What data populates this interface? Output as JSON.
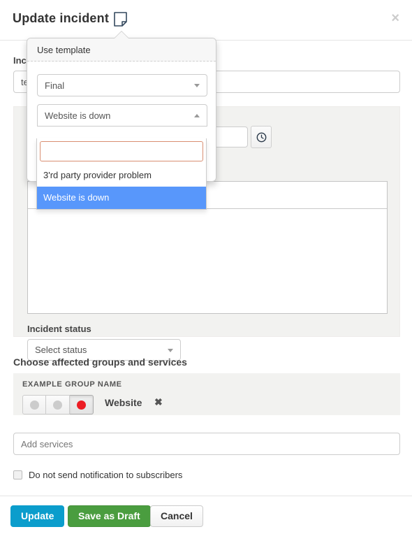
{
  "header": {
    "title": "Update incident",
    "template_icon": "note-template-icon",
    "close_label": "×"
  },
  "form": {
    "incident_title_label": "Incident title",
    "incident_title_value": "te",
    "time_value": "",
    "time_icon": "clock-icon",
    "incident_status_label": "Incident status",
    "status_selected": "Select status",
    "message_value": ""
  },
  "affected": {
    "section_label": "Choose affected groups and services",
    "group_name": "EXAMPLE GROUP NAME",
    "service_name": "Website",
    "remove_icon": "✖",
    "status_buttons": [
      {
        "name": "status-option-1",
        "color": "#cccccc",
        "active": false
      },
      {
        "name": "status-option-2",
        "color": "#cccccc",
        "active": false
      },
      {
        "name": "status-option-3",
        "color": "#ec1c24",
        "active": true
      }
    ],
    "add_services_placeholder": "Add services"
  },
  "notification": {
    "checkbox_label": "Do not send notification to subscribers",
    "checked": false
  },
  "footer": {
    "update_label": "Update",
    "draft_label": "Save as Draft",
    "cancel_label": "Cancel"
  },
  "popover": {
    "title": "Use template",
    "type_selected": "Final",
    "template_selected": "Website is down",
    "search_value": "",
    "options": [
      "3'rd party provider problem",
      "Website is down"
    ],
    "highlighted_option": "Website is down"
  },
  "colors": {
    "update_button": "#0b9dcc",
    "draft_button": "#4a9d3f",
    "highlight_blue": "#5897fb",
    "search_border": "#d98f72",
    "status_red": "#ec1c24",
    "panel_grey": "#f2f2f0"
  }
}
